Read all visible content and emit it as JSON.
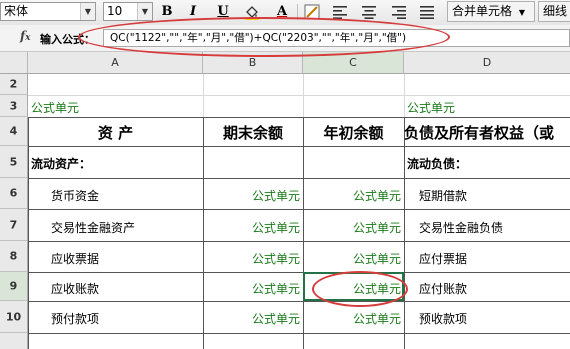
{
  "toolbar": {
    "font_name": "宋体",
    "font_size": "10",
    "bold_label": "B",
    "italic_label": "I",
    "underline_label": "U",
    "font_color_label": "A",
    "merge_label": "合并单元格",
    "border_label": "细线"
  },
  "formula_bar": {
    "label": "输入公式：",
    "formula": "QC(\"1122\",\"\",\"年\",\"月\",\"借\")+QC(\"2203\",\"\",\"年\",\"月\",\"借\")"
  },
  "columns": [
    "A",
    "B",
    "C",
    "D"
  ],
  "rows": [
    "2",
    "3",
    "4",
    "5",
    "6",
    "7",
    "8",
    "9",
    "10"
  ],
  "cells": {
    "r3_a": "公式单元",
    "r3_d": "公式单元",
    "r4_a": "资        产",
    "r4_b": "期末余额",
    "r4_c": "年初余额",
    "r4_d": "负债及所有者权益（或",
    "r5_a": "流动资产：",
    "r5_d": "流动负债：",
    "r6_a": "货币资金",
    "r6_b": "公式单元",
    "r6_c": "公式单元",
    "r6_d": "短期借款",
    "r7_a": "交易性金融资产",
    "r7_b": "公式单元",
    "r7_c": "公式单元",
    "r7_d": "交易性金融负债",
    "r8_a": "应收票据",
    "r8_b": "公式单元",
    "r8_c": "公式单元",
    "r8_d": "应付票据",
    "r9_a": "应收账款",
    "r9_b": "公式单元",
    "r9_c": "公式单元",
    "r9_d": "应付账款",
    "r10_a": "预付款项",
    "r10_b": "公式单元",
    "r10_c": "公式单元",
    "r10_d": "预收款项"
  },
  "selected_cell": "C9",
  "colors": {
    "formula_cell_text": "#1a7a1a",
    "annotation": "#d63c3c",
    "selection": "#217346"
  }
}
